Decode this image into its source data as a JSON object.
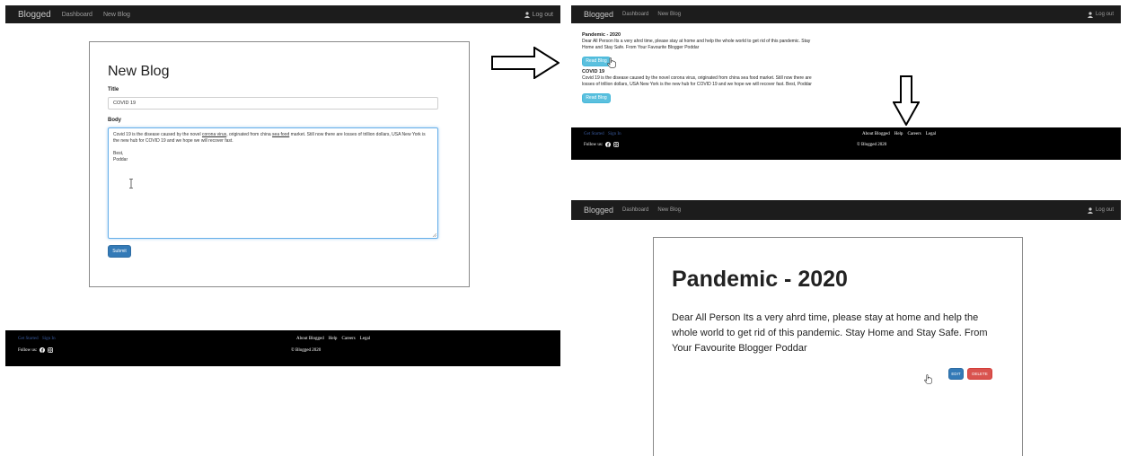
{
  "nav": {
    "brand": "Blogged",
    "dashboard": "Dashboard",
    "new_blog": "New Blog",
    "logout": "Log out"
  },
  "footer": {
    "get_started": "Get Started",
    "sign_in": "Sign In",
    "about": "About Blogged",
    "help": "Help",
    "careers": "Careers",
    "legal": "Legal",
    "follow_us": "Follow us:",
    "copyright": "© Blogged 2020"
  },
  "new_blog_form": {
    "heading": "New Blog",
    "title_label": "Title",
    "title_value": "COVID 19",
    "body_label": "Body",
    "body_pre_1": "Covid 19 is the disease caused by the novel ",
    "body_link_1": "corona virus",
    "body_mid": ", originated from china ",
    "body_link_2": "sea food",
    "body_post": " market. Still now there are losses of trillion dollars, USA New York is the new hub for COVID 19 and we hope we will recover fast.",
    "body_sign_1": "Best,",
    "body_sign_2": "Poddar",
    "submit": "Submit"
  },
  "blog_list": {
    "posts": [
      {
        "title": "Pandemic - 2020",
        "body": "Dear All Person Its a very ahrd time, please stay at home and help the whole world to get rid of this pandemic. Stay Home and Stay Safe. From Your Favourite Blogger Poddar",
        "read": "Read Blog"
      },
      {
        "title": "COVID 19",
        "body": "Covid 19 is the disease caused by the novel corona virus, originated from china sea food market. Still now there are losses of trillion dollars, USA New York is the new hub for COVID 19 and we hope we will recover fast. Best, Poddar",
        "read": "Read Blog"
      }
    ]
  },
  "blog_detail": {
    "title": "Pandemic - 2020",
    "body": "Dear All Person Its a very ahrd time, please stay at home and help the whole world to get rid of this pandemic. Stay Home and Stay Safe. From Your Favourite Blogger Poddar",
    "edit": "EDIT",
    "delete": "DELETE"
  },
  "icons": {
    "user": "user-icon",
    "facebook": "facebook-icon",
    "instagram": "instagram-icon",
    "text_cursor": "text-cursor-icon",
    "hand_pointer": "hand-pointer-icon",
    "arrow_right": "arrow-right-icon",
    "arrow_down": "arrow-down-icon"
  },
  "colors": {
    "navbar": "#1c1c1c",
    "footer": "#000000",
    "primary": "#337ab7",
    "danger": "#d9534f",
    "info": "#5bc0de"
  }
}
